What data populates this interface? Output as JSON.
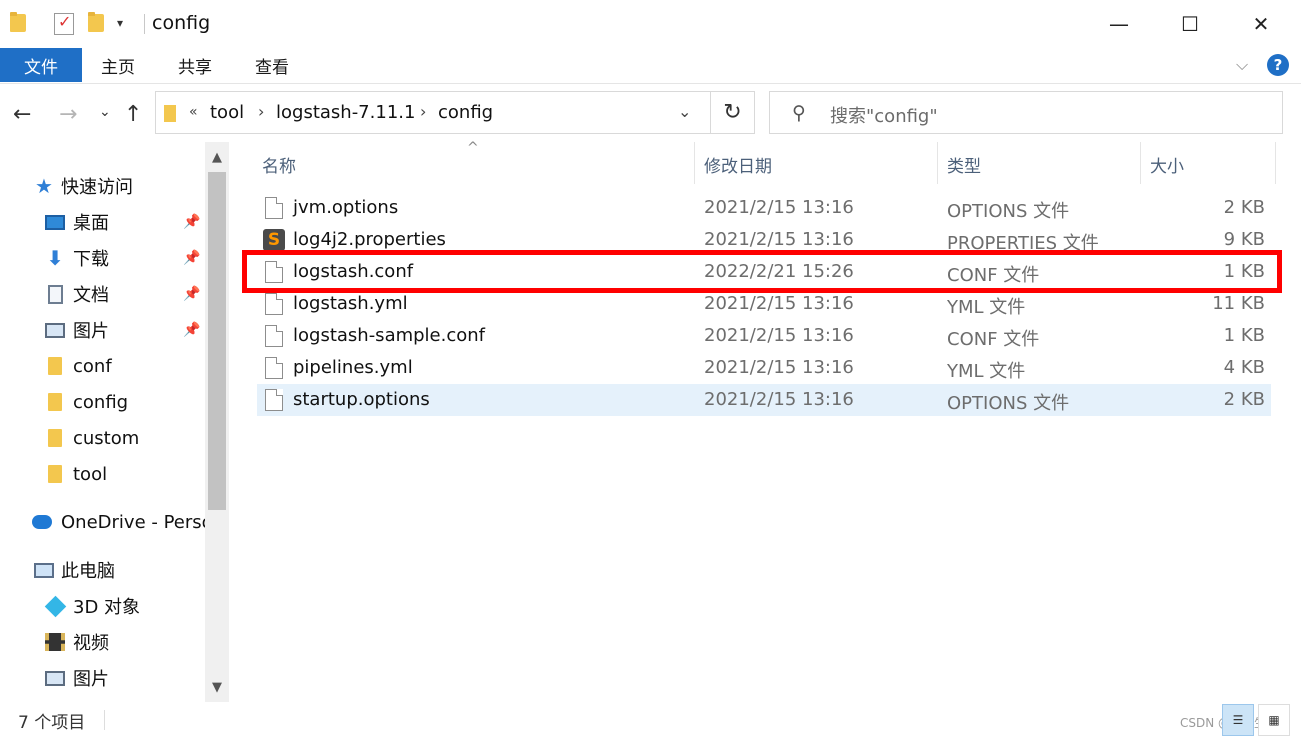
{
  "window": {
    "title": "config",
    "minimize": "—",
    "maximize": "☐",
    "close": "✕"
  },
  "ribbon": {
    "tabs": [
      "文件",
      "主页",
      "共享",
      "查看"
    ],
    "expand": "⌵",
    "help": "?"
  },
  "nav": {
    "back": "←",
    "forward": "→",
    "recent": "⌄",
    "up": "↑",
    "overflow": "«",
    "breadcrumb": [
      "tool",
      "logstash-7.11.1",
      "config"
    ],
    "sep": "›",
    "dropdown": "⌄",
    "refresh": "↻",
    "search_placeholder": "搜索\"config\""
  },
  "sidebar": {
    "quick_access": "快速访问",
    "items": [
      {
        "label": "桌面",
        "pinned": true
      },
      {
        "label": "下载",
        "pinned": true
      },
      {
        "label": "文档",
        "pinned": true
      },
      {
        "label": "图片",
        "pinned": true
      },
      {
        "label": "conf",
        "pinned": false
      },
      {
        "label": "config",
        "pinned": false
      },
      {
        "label": "custom",
        "pinned": false
      },
      {
        "label": "tool",
        "pinned": false
      }
    ],
    "onedrive": "OneDrive - Perso",
    "this_pc": "此电脑",
    "pc_items": [
      "3D 对象",
      "视频",
      "图片"
    ],
    "pin_glyph": "📌"
  },
  "scroll": {
    "up": "▲",
    "down": "▼"
  },
  "columns": {
    "name": "名称",
    "date": "修改日期",
    "type": "类型",
    "size": "大小",
    "sort_caret": "^"
  },
  "files": [
    {
      "name": "jvm.options",
      "date": "2021/2/15 13:16",
      "type": "OPTIONS 文件",
      "size": "2 KB",
      "icon": "file-icon"
    },
    {
      "name": "log4j2.properties",
      "date": "2021/2/15 13:16",
      "type": "PROPERTIES 文件",
      "size": "9 KB",
      "icon": "sublime-icon"
    },
    {
      "name": "logstash.conf",
      "date": "2022/2/21 15:26",
      "type": "CONF 文件",
      "size": "1 KB",
      "icon": "file-icon"
    },
    {
      "name": "logstash.yml",
      "date": "2021/2/15 13:16",
      "type": "YML 文件",
      "size": "11 KB",
      "icon": "file-icon"
    },
    {
      "name": "logstash-sample.conf",
      "date": "2021/2/15 13:16",
      "type": "CONF 文件",
      "size": "1 KB",
      "icon": "file-icon"
    },
    {
      "name": "pipelines.yml",
      "date": "2021/2/15 13:16",
      "type": "YML 文件",
      "size": "4 KB",
      "icon": "file-icon"
    },
    {
      "name": "startup.options",
      "date": "2021/2/15 13:16",
      "type": "OPTIONS 文件",
      "size": "2 KB",
      "icon": "file-icon"
    }
  ],
  "status": {
    "count": "7 个项目",
    "watermark": "CSDN @拆半生缘",
    "details_view": "☰",
    "icons_view": "▦"
  },
  "colors": {
    "accent": "#1f6fc6",
    "highlight": "#ff0000",
    "selected_row": "#e5f1fb"
  }
}
